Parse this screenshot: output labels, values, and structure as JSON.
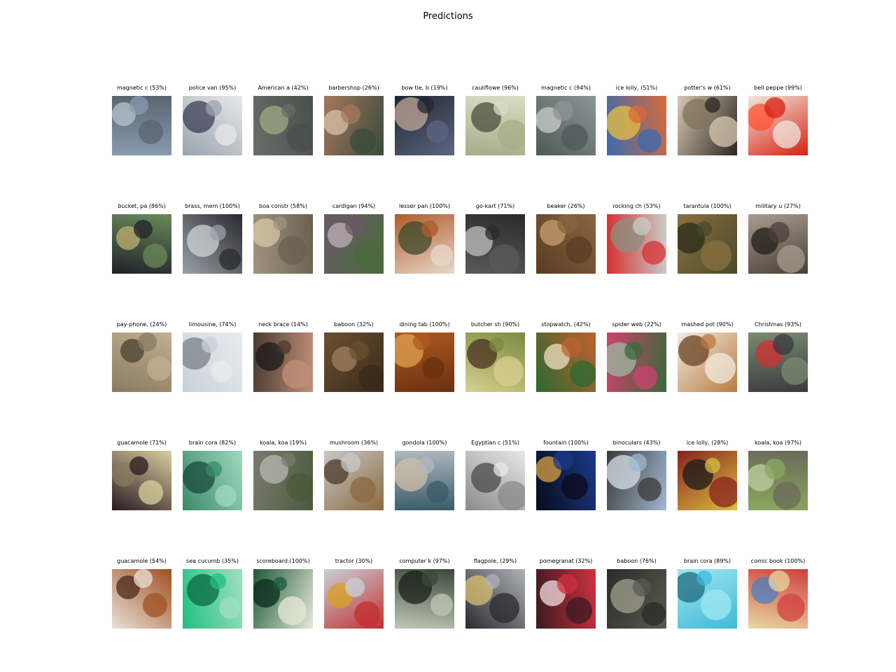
{
  "title": "Predictions",
  "predictions": [
    {
      "label": "magnetic c (53%)",
      "colors": [
        "#8a9bb0",
        "#5a6470",
        "#b8c4cf"
      ]
    },
    {
      "label": "police van (95%)",
      "colors": [
        "#9aa3ad",
        "#e8e8ea",
        "#3b3f55"
      ]
    },
    {
      "label": "American a (42%)",
      "colors": [
        "#6a6e6a",
        "#4a4f4c",
        "#9cab84"
      ]
    },
    {
      "label": "barbershop (26%)",
      "colors": [
        "#a4785d",
        "#3a4a3c",
        "#d9c2a8"
      ]
    },
    {
      "label": "bow tie, b (19%)",
      "colors": [
        "#1f2530",
        "#5c6680",
        "#c0a898"
      ]
    },
    {
      "label": "cauliflowe (96%)",
      "colors": [
        "#d8dcc4",
        "#a8ac8a",
        "#4a4d3c"
      ]
    },
    {
      "label": "magnetic c (94%)",
      "colors": [
        "#8c9694",
        "#4f5a58",
        "#c8cfcc"
      ]
    },
    {
      "label": "ice lolly, (51%)",
      "colors": [
        "#d86a3a",
        "#3a6ab0",
        "#e8c040"
      ]
    },
    {
      "label": "potter's w (61%)",
      "colors": [
        "#2a2622",
        "#d8c8b0",
        "#80745c"
      ]
    },
    {
      "label": "bell peppe (99%)",
      "colors": [
        "#d82010",
        "#f0e8e0",
        "#ff5030"
      ]
    },
    {
      "label": "bucket, pa (86%)",
      "colors": [
        "#20222a",
        "#6a8a5a",
        "#c0b070"
      ]
    },
    {
      "label": "brass, mem (100%)",
      "colors": [
        "#9aa0a8",
        "#2a2a2e",
        "#d0d4d8"
      ]
    },
    {
      "label": "boa constr (58%)",
      "colors": [
        "#a09480",
        "#6a6050",
        "#d8c8a8"
      ]
    },
    {
      "label": "cardigan (94%)",
      "colors": [
        "#6a5a6a",
        "#4a6a3a",
        "#c0b0b8"
      ]
    },
    {
      "label": "lesser pan (100%)",
      "colors": [
        "#b05a2a",
        "#e8d8c8",
        "#3a4a2a"
      ]
    },
    {
      "label": "go-kart (71%)",
      "colors": [
        "#2a2a2a",
        "#5a5a5a",
        "#c0c0c0"
      ]
    },
    {
      "label": "beaker (26%)",
      "colors": [
        "#8a6440",
        "#5a3c22",
        "#c8a070"
      ]
    },
    {
      "label": "rocking ch (53%)",
      "colors": [
        "#c8ccc8",
        "#d83030",
        "#8a9080"
      ]
    },
    {
      "label": "tarantula (100%)",
      "colors": [
        "#4a4a2a",
        "#8a7040",
        "#2a2a1a"
      ]
    },
    {
      "label": "military u (27%)",
      "colors": [
        "#4a4038",
        "#a89c90",
        "#201c18"
      ]
    },
    {
      "label": "pay-phone, (24%)",
      "colors": [
        "#8a7a60",
        "#c0b090",
        "#4a4030"
      ]
    },
    {
      "label": "limousine, (74%)",
      "colors": [
        "#c8d0d8",
        "#e8ecef",
        "#7a8088"
      ]
    },
    {
      "label": "neck brace (14%)",
      "colors": [
        "#4a3a30",
        "#c09078",
        "#1a1a1a"
      ]
    },
    {
      "label": "baboon (32%)",
      "colors": [
        "#6a5030",
        "#3a2a1a",
        "#a08060"
      ]
    },
    {
      "label": "dining tab (100%)",
      "colors": [
        "#b05a20",
        "#6a3010",
        "#e0a050"
      ]
    },
    {
      "label": "butcher sh (90%)",
      "colors": [
        "#7a8a40",
        "#d8d090",
        "#4a3020"
      ]
    },
    {
      "label": "stopwatch, (42%)",
      "colors": [
        "#c06030",
        "#2a6a30",
        "#f0e0c0"
      ]
    },
    {
      "label": "spider web (22%)",
      "colors": [
        "#3a6a3a",
        "#d04070",
        "#9ab8a0"
      ]
    },
    {
      "label": "mashed pot (90%)",
      "colors": [
        "#b87a40",
        "#f0ece0",
        "#6a4020"
      ]
    },
    {
      "label": "Christmas  (93%)",
      "colors": [
        "#3a3a40",
        "#7a8a70",
        "#d03030"
      ]
    },
    {
      "label": "guacamole (71%)",
      "colors": [
        "#2a1a20",
        "#d8d0a0",
        "#8a7a60"
      ]
    },
    {
      "label": "brain cora (82%)",
      "colors": [
        "#3a8a6a",
        "#a0d8c0",
        "#1a4a3a"
      ]
    },
    {
      "label": "koala, koa (19%)",
      "colors": [
        "#7a7a70",
        "#4a5a3a",
        "#b8b8b0"
      ]
    },
    {
      "label": "mushroom (36%)",
      "colors": [
        "#c8c8c8",
        "#8a6a40",
        "#4a3a2a"
      ]
    },
    {
      "label": "gondola (100%)",
      "colors": [
        "#b0b8c0",
        "#3a5a6a",
        "#d0c0a8"
      ]
    },
    {
      "label": "Egyptian c (51%)",
      "colors": [
        "#e8e8e8",
        "#8a8a8a",
        "#4a4a4a"
      ]
    },
    {
      "label": "fountain (100%)",
      "colors": [
        "#1a3a8a",
        "#0a0a1a",
        "#d8a040"
      ]
    },
    {
      "label": "binoculars (43%)",
      "colors": [
        "#a0b8d0",
        "#3a3a3a",
        "#d8e0e8"
      ]
    },
    {
      "label": "ice lolly, (28%)",
      "colors": [
        "#d8c040",
        "#8a2020",
        "#1a1a1a"
      ]
    },
    {
      "label": "koala, koa (97%)",
      "colors": [
        "#8aa860",
        "#6a6a5a",
        "#c0d0a0"
      ]
    },
    {
      "label": "guacamole (54%)",
      "colors": [
        "#e8e0d8",
        "#a05020",
        "#4a2a1a"
      ]
    },
    {
      "label": "sea cucumb (35%)",
      "colors": [
        "#20c080",
        "#a0e0c0",
        "#0a6a40"
      ]
    },
    {
      "label": "scoreboard (100%)",
      "colors": [
        "#1a5a3a",
        "#e8e8d8",
        "#0a2a1a"
      ]
    },
    {
      "label": "tractor (30%)",
      "colors": [
        "#c8d0d8",
        "#c03030",
        "#d8a020"
      ]
    },
    {
      "label": "computer k (97%)",
      "colors": [
        "#3a4a3a",
        "#c0c8b8",
        "#1a2018"
      ]
    },
    {
      "label": "flagpole,  (29%)",
      "colors": [
        "#b0b0b8",
        "#2a2a30",
        "#d8c070"
      ]
    },
    {
      "label": "pomegranat (32%)",
      "colors": [
        "#d03040",
        "#3a1a20",
        "#f0e0e0"
      ]
    },
    {
      "label": "baboon (76%)",
      "colors": [
        "#5a5a50",
        "#2a2a28",
        "#a0a090"
      ]
    },
    {
      "label": "brain cora (89%)",
      "colors": [
        "#40b8d8",
        "#a0e8f0",
        "#206a80"
      ]
    },
    {
      "label": "comic book (100%)",
      "colors": [
        "#e8d8a0",
        "#d04040",
        "#4a80c0"
      ]
    }
  ]
}
